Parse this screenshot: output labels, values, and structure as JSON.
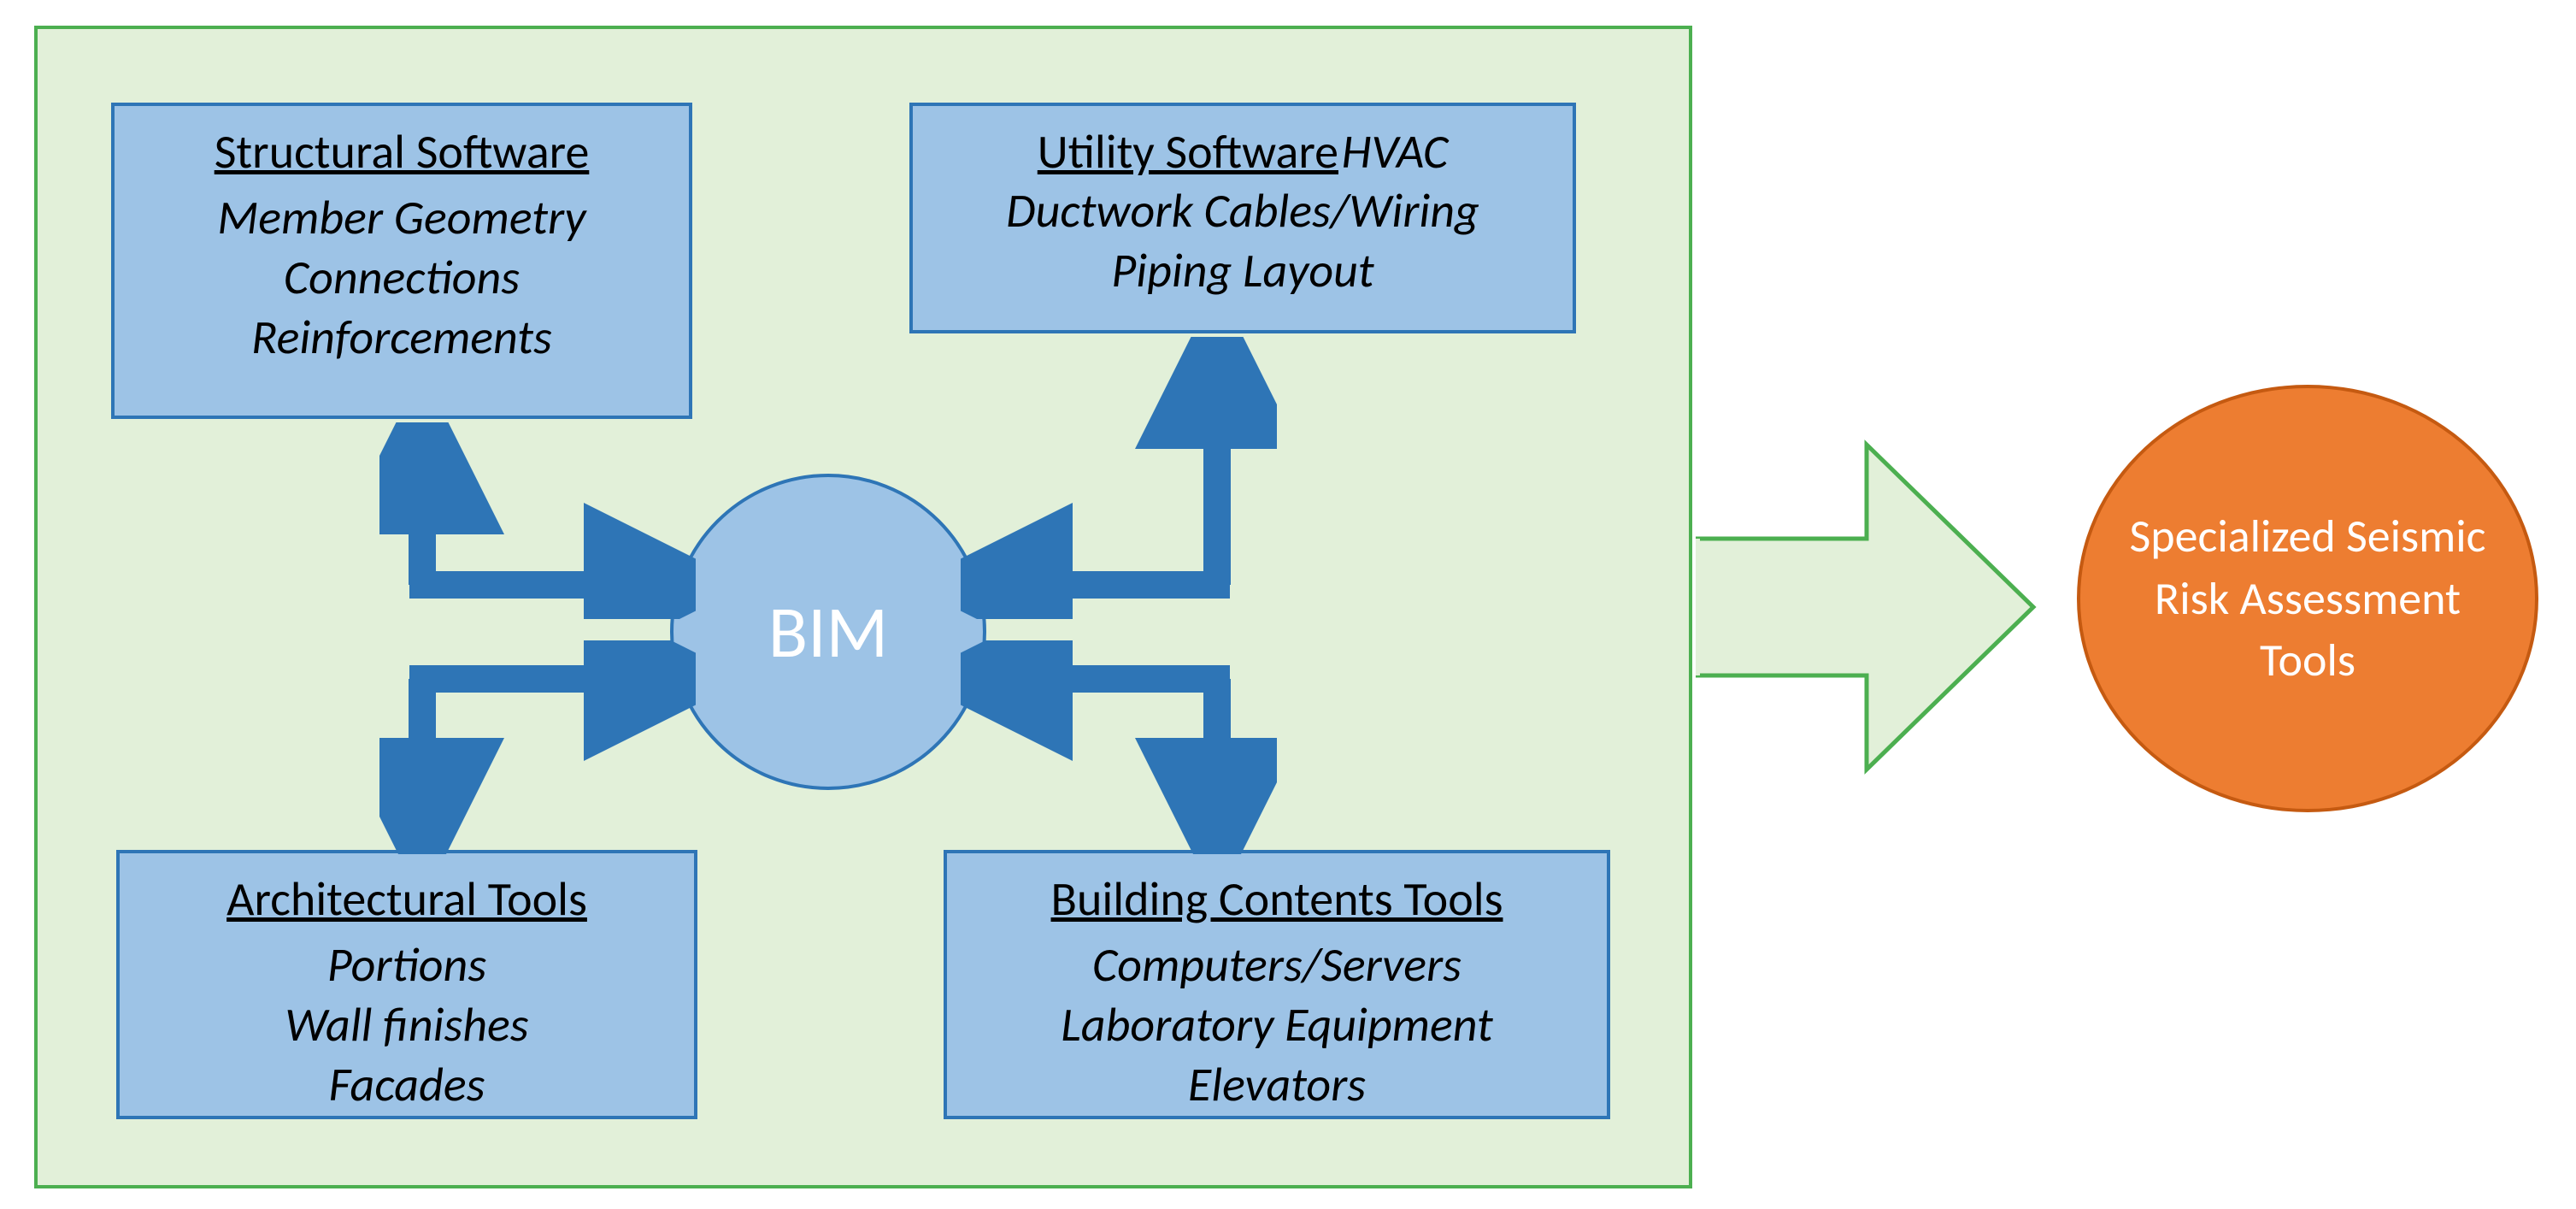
{
  "colors": {
    "containerBg": "#E2F0D9",
    "containerBorder": "#4CAF50",
    "boxBg": "#9DC3E6",
    "boxBorder": "#2E75B6",
    "arrowBlue": "#2E75B6",
    "outputBg": "#ED7D31",
    "outputBorder": "#C55A11",
    "outputText": "#ffffff"
  },
  "diagram": {
    "hub": {
      "label": "BIM"
    },
    "boxes": {
      "top_left": {
        "title": "Structural Software",
        "items": [
          "Member Geometry",
          "Connections",
          "Reinforcements"
        ]
      },
      "top_right": {
        "title": "Utility Software",
        "title_extra": "HVAC",
        "items": [
          "Ductwork Cables/Wiring",
          "Piping Layout"
        ]
      },
      "bottom_left": {
        "title": "Architectural Tools",
        "items": [
          "Portions",
          "Wall finishes",
          "Facades"
        ]
      },
      "bottom_right": {
        "title": "Building Contents Tools",
        "items": [
          "Computers/Servers",
          "Laboratory Equipment",
          "Elevators"
        ]
      }
    },
    "output": {
      "label": "Specialized Seismic Risk Assessment Tools"
    }
  }
}
